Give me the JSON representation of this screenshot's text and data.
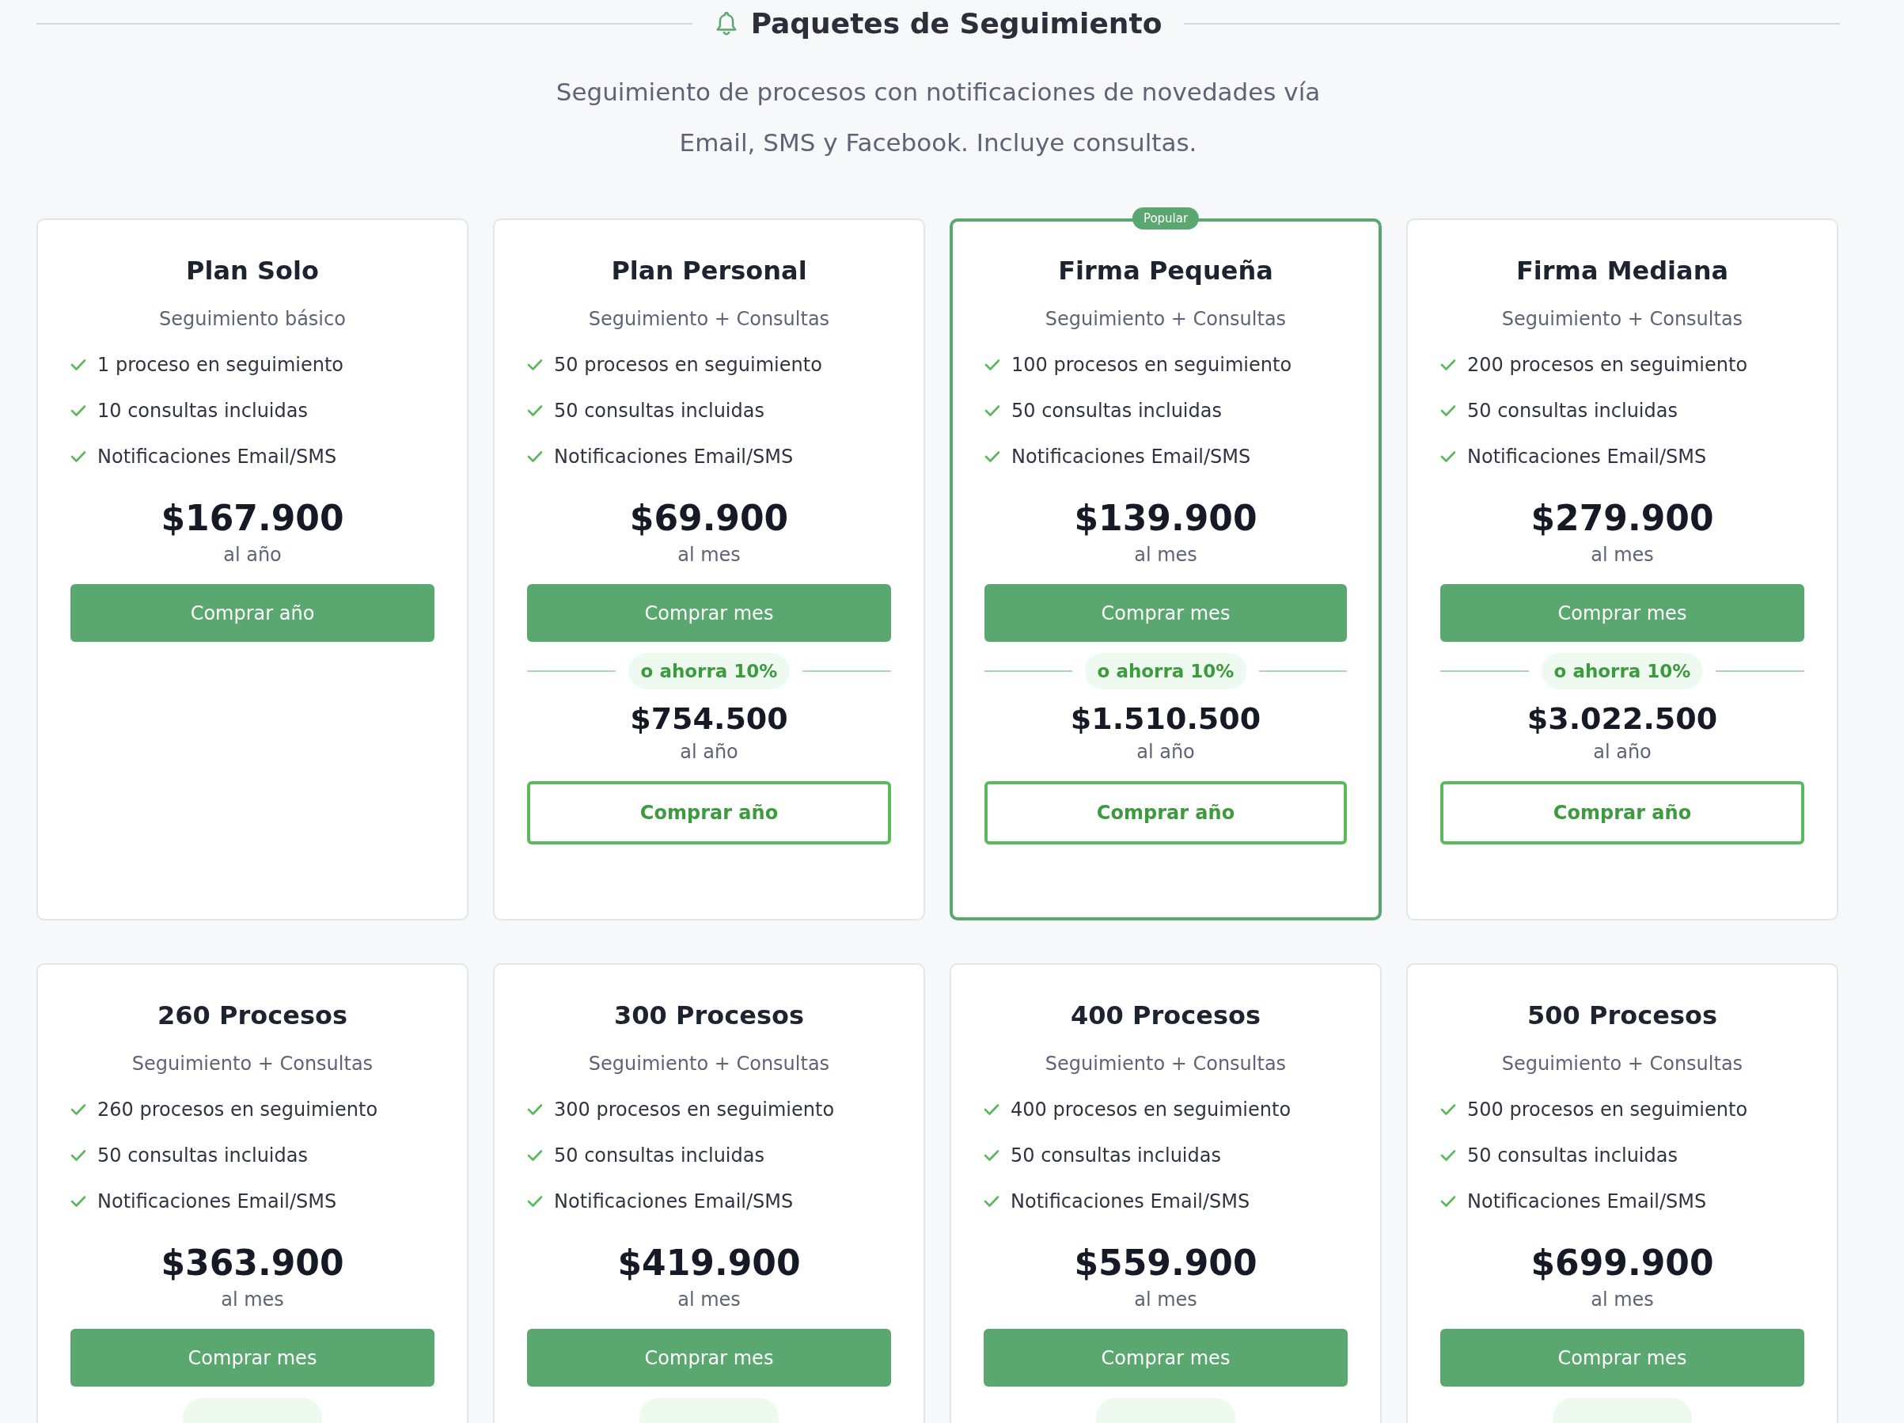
{
  "section": {
    "title": "Paquetes de Seguimiento",
    "description": [
      "Seguimiento de procesos con notificaciones de novedades vía",
      "Email, SMS y Facebook. Incluye consultas."
    ]
  },
  "plans": [
    {
      "name": "Plan Solo",
      "subtitle": "Seguimiento básico",
      "featured": false,
      "features": [
        "1 proceso en seguimiento",
        "10 consultas incluidas",
        "Notificaciones Email/SMS"
      ],
      "price": "$167.900",
      "period": "al año",
      "button": "Comprar año"
    },
    {
      "name": "Plan Personal",
      "subtitle": "Seguimiento + Consultas",
      "featured": false,
      "features": [
        "50 procesos en seguimiento",
        "50 consultas incluidas",
        "Notificaciones Email/SMS"
      ],
      "price": "$69.900",
      "period": "al mes",
      "button": "Comprar mes",
      "savings": "o ahorra 10%",
      "annual_price": "$754.500",
      "annual_period": "al año",
      "annual_button": "Comprar año"
    },
    {
      "name": "Firma Pequeña",
      "subtitle": "Seguimiento + Consultas",
      "featured": true,
      "badge": "Popular",
      "features": [
        "100 procesos en seguimiento",
        "50 consultas incluidas",
        "Notificaciones Email/SMS"
      ],
      "price": "$139.900",
      "period": "al mes",
      "button": "Comprar mes",
      "savings": "o ahorra 10%",
      "annual_price": "$1.510.500",
      "annual_period": "al año",
      "annual_button": "Comprar año"
    },
    {
      "name": "Firma Mediana",
      "subtitle": "Seguimiento + Consultas",
      "featured": false,
      "features": [
        "200 procesos en seguimiento",
        "50 consultas incluidas",
        "Notificaciones Email/SMS"
      ],
      "price": "$279.900",
      "period": "al mes",
      "button": "Comprar mes",
      "savings": "o ahorra 10%",
      "annual_price": "$3.022.500",
      "annual_period": "al año",
      "annual_button": "Comprar año"
    },
    {
      "name": "260 Procesos",
      "subtitle": "Seguimiento + Consultas",
      "featured": false,
      "features": [
        "260 procesos en seguimiento",
        "50 consultas incluidas",
        "Notificaciones Email/SMS"
      ],
      "price": "$363.900",
      "period": "al mes",
      "button": "Comprar mes",
      "savings_cut": true
    },
    {
      "name": "300 Procesos",
      "subtitle": "Seguimiento + Consultas",
      "featured": false,
      "features": [
        "300 procesos en seguimiento",
        "50 consultas incluidas",
        "Notificaciones Email/SMS"
      ],
      "price": "$419.900",
      "period": "al mes",
      "button": "Comprar mes",
      "savings_cut": true
    },
    {
      "name": "400 Procesos",
      "subtitle": "Seguimiento + Consultas",
      "featured": false,
      "features": [
        "400 procesos en seguimiento",
        "50 consultas incluidas",
        "Notificaciones Email/SMS"
      ],
      "price": "$559.900",
      "period": "al mes",
      "button": "Comprar mes",
      "savings_cut": true
    },
    {
      "name": "500 Procesos",
      "subtitle": "Seguimiento + Consultas",
      "featured": false,
      "features": [
        "500 procesos en seguimiento",
        "50 consultas incluidas",
        "Notificaciones Email/SMS"
      ],
      "price": "$699.900",
      "period": "al mes",
      "button": "Comprar mes",
      "savings_cut": true
    }
  ]
}
